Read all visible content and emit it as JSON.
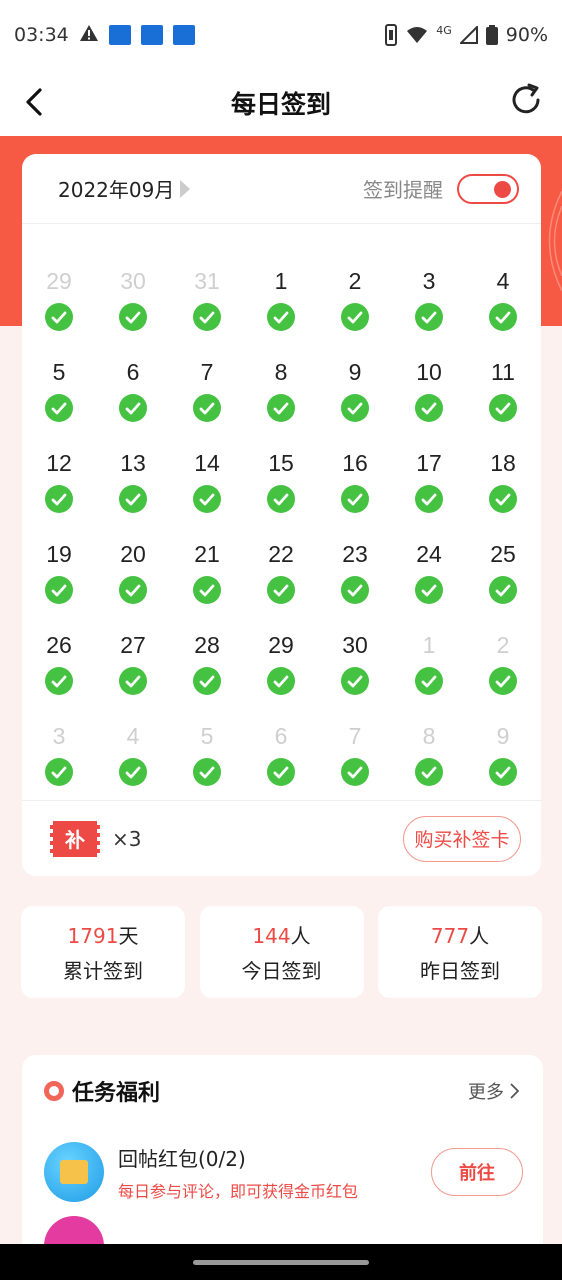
{
  "status_bar": {
    "time": "03:34",
    "network": "4G",
    "battery": "90%"
  },
  "header": {
    "title": "每日签到"
  },
  "calendar": {
    "month": "2022年09月",
    "remind_label": "签到提醒",
    "remind_on": true,
    "weeks": [
      [
        {
          "d": "29",
          "m": true
        },
        {
          "d": "30",
          "m": true
        },
        {
          "d": "31",
          "m": true
        },
        {
          "d": "1"
        },
        {
          "d": "2"
        },
        {
          "d": "3"
        },
        {
          "d": "4"
        }
      ],
      [
        {
          "d": "5"
        },
        {
          "d": "6"
        },
        {
          "d": "7"
        },
        {
          "d": "8"
        },
        {
          "d": "9"
        },
        {
          "d": "10"
        },
        {
          "d": "11"
        }
      ],
      [
        {
          "d": "12"
        },
        {
          "d": "13"
        },
        {
          "d": "14"
        },
        {
          "d": "15"
        },
        {
          "d": "16"
        },
        {
          "d": "17"
        },
        {
          "d": "18"
        }
      ],
      [
        {
          "d": "19"
        },
        {
          "d": "20"
        },
        {
          "d": "21"
        },
        {
          "d": "22"
        },
        {
          "d": "23"
        },
        {
          "d": "24"
        },
        {
          "d": "25"
        }
      ],
      [
        {
          "d": "26"
        },
        {
          "d": "27"
        },
        {
          "d": "28"
        },
        {
          "d": "29"
        },
        {
          "d": "30"
        },
        {
          "d": "1",
          "m": true
        },
        {
          "d": "2",
          "m": true
        }
      ],
      [
        {
          "d": "3",
          "m": true
        },
        {
          "d": "4",
          "m": true
        },
        {
          "d": "5",
          "m": true
        },
        {
          "d": "6",
          "m": true
        },
        {
          "d": "7",
          "m": true
        },
        {
          "d": "8",
          "m": true
        },
        {
          "d": "9",
          "m": true
        }
      ]
    ],
    "makeup_card_icon_text": "补",
    "makeup_card_count": "×3",
    "buy_button": "购买补签卡"
  },
  "stats": [
    {
      "value": "1791",
      "unit": "天",
      "label": "累计签到"
    },
    {
      "value": "144",
      "unit": "人",
      "label": "今日签到"
    },
    {
      "value": "777",
      "unit": "人",
      "label": "昨日签到"
    }
  ],
  "tasks": {
    "title": "任务福利",
    "more": "更多",
    "items": [
      {
        "name": "回帖红包(0/2)",
        "desc": "每日参与评论，即可获得金币红包",
        "button": "前往"
      }
    ]
  },
  "colors": {
    "accent": "#ee4a45",
    "check": "#46c243",
    "band": "#f65a45",
    "background": "#fdf1f0"
  }
}
